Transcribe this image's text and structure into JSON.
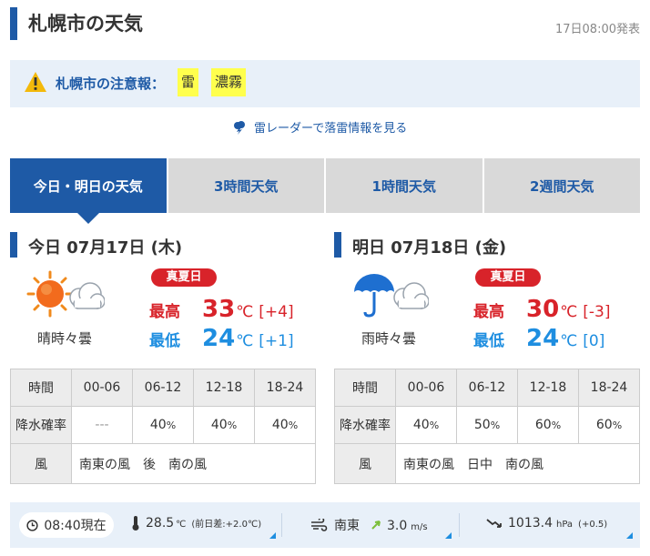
{
  "header": {
    "title": "札幌市の天気",
    "published": "17日08:00発表"
  },
  "warning": {
    "label": "札幌市の注意報：",
    "items": [
      "雷",
      "濃霧"
    ]
  },
  "radar_link": "雷レーダーで落雷情報を見る",
  "tabs": [
    "今日・明日の天気",
    "3時間天気",
    "1時間天気",
    "2週間天気"
  ],
  "today": {
    "title": "今日 07月17日 (木)",
    "weather": "晴時々曇",
    "badge": "真夏日",
    "high_label": "最高",
    "high": "33",
    "high_unit": "℃",
    "high_diff": "[+4]",
    "low_label": "最低",
    "low": "24",
    "low_unit": "℃",
    "low_diff": "[+1]",
    "table": {
      "time_label": "時間",
      "times": [
        "00-06",
        "06-12",
        "12-18",
        "18-24"
      ],
      "rain_label": "降水確率",
      "rain": [
        {
          "v": "---",
          "u": ""
        },
        {
          "v": "40",
          "u": "%"
        },
        {
          "v": "40",
          "u": "%"
        },
        {
          "v": "40",
          "u": "%"
        }
      ],
      "wind_label": "風",
      "wind": "南東の風　後　南の風"
    }
  },
  "tomorrow": {
    "title": "明日 07月18日 (金)",
    "weather": "雨時々曇",
    "badge": "真夏日",
    "high_label": "最高",
    "high": "30",
    "high_unit": "℃",
    "high_diff": "[-3]",
    "low_label": "最低",
    "low": "24",
    "low_unit": "℃",
    "low_diff": "[0]",
    "table": {
      "time_label": "時間",
      "times": [
        "00-06",
        "06-12",
        "12-18",
        "18-24"
      ],
      "rain_label": "降水確率",
      "rain": [
        {
          "v": "40",
          "u": "%"
        },
        {
          "v": "50",
          "u": "%"
        },
        {
          "v": "60",
          "u": "%"
        },
        {
          "v": "60",
          "u": "%"
        }
      ],
      "wind_label": "風",
      "wind": "南東の風　日中　南の風"
    }
  },
  "current": {
    "time": "08:40現在",
    "temp": "28.5",
    "temp_unit": "℃",
    "temp_diff": "(前日差:+2.0℃)",
    "wind_dir": "南東",
    "wind_speed": "3.0",
    "wind_unit": "m/s",
    "pressure": "1013.4",
    "pressure_unit": "hPa",
    "pressure_diff": "(+0.5)"
  },
  "colors": {
    "brand": "#1e5aa6",
    "high": "#d8232a",
    "low": "#1e8ee0",
    "warning_bg": "#ffff4d"
  }
}
